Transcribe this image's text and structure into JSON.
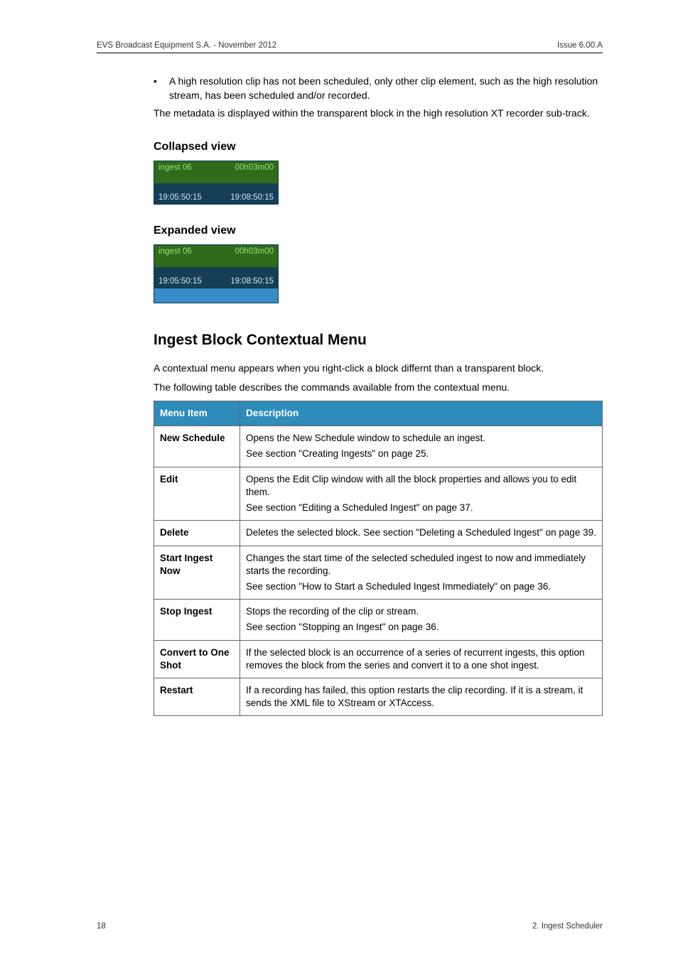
{
  "header": {
    "left": "EVS Broadcast Equipment S.A.  - November 2012",
    "right": "Issue 6.00.A"
  },
  "bullet": {
    "dot": "•",
    "text": "A high resolution clip has not been scheduled, only other clip element, such as the high resolution stream, has been scheduled and/or recorded."
  },
  "para1": "The metadata is displayed within the transparent block in the high resolution XT recorder sub-track.",
  "collapsed": {
    "heading": "Collapsed view",
    "topLeft": "ingest 06",
    "topRight": "00h03m00",
    "botLeft": "19:05:50:15",
    "botRight": "19:08:50:15"
  },
  "expanded": {
    "heading": "Expanded view",
    "topLeft": "ingest 06",
    "topRight": "00h03m00",
    "botLeft": "19:05:50:15",
    "botRight": "19:08:50:15"
  },
  "contextual": {
    "heading": "Ingest Block Contextual Menu",
    "intro1": "A contextual menu appears when you right-click a block differnt than a transparent block.",
    "intro2": "The following table describes the commands available from the contextual menu.",
    "headers": {
      "c1": "Menu Item",
      "c2": "Description"
    },
    "rows": [
      {
        "item": "New Schedule",
        "desc": "Opens the New Schedule window to schedule an ingest.\nSee section \"Creating Ingests\" on page 25."
      },
      {
        "item": "Edit",
        "desc": "Opens the Edit Clip window with all the block properties and allows you to edit them.\nSee section \"Editing a Scheduled Ingest\" on page 37."
      },
      {
        "item": "Delete",
        "desc": "Deletes the selected block. See section \"Deleting a Scheduled Ingest\" on page 39."
      },
      {
        "item": "Start Ingest Now",
        "desc": "Changes the start time of the selected scheduled ingest to now and immediately starts the recording.\nSee section \"How to Start a Scheduled Ingest Immediately\" on page 36."
      },
      {
        "item": "Stop Ingest",
        "desc": "Stops the recording of the clip or stream.\nSee section \"Stopping an Ingest\" on page 36."
      },
      {
        "item": "Convert to One Shot",
        "desc": "If the selected block is an occurrence of a series of recurrent ingests, this option removes the block from the series and convert it to a one shot ingest."
      },
      {
        "item": "Restart",
        "desc": "If a recording has failed, this option restarts the clip recording. If it is a stream, it sends the XML file to XStream or XTAccess."
      }
    ]
  },
  "footer": {
    "left": "18",
    "right": "2. Ingest Scheduler"
  }
}
